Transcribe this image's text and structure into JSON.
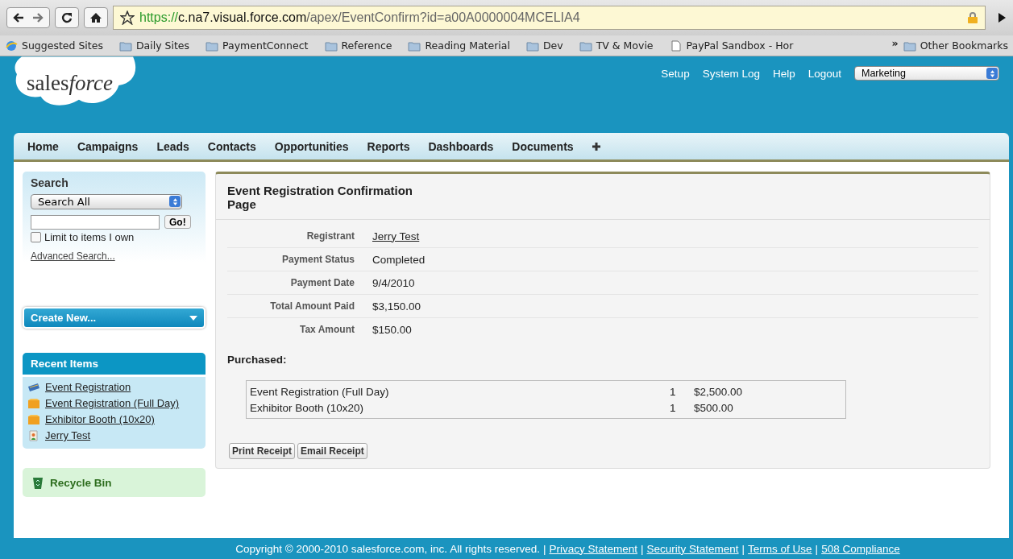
{
  "browser": {
    "url": [
      {
        "kind": "scheme",
        "text": "https://"
      },
      {
        "kind": "host",
        "text": "c.na7.visual.force.com"
      },
      {
        "kind": "path",
        "text": "/apex/EventConfirm?id=a00A0000004MCELIA4"
      }
    ],
    "bookmarks": [
      {
        "kind": "site",
        "label": "Suggested Sites"
      },
      {
        "kind": "folder",
        "label": "Daily Sites"
      },
      {
        "kind": "folder",
        "label": "PaymentConnect"
      },
      {
        "kind": "folder",
        "label": "Reference"
      },
      {
        "kind": "folder",
        "label": "Reading Material"
      },
      {
        "kind": "folder",
        "label": "Dev"
      },
      {
        "kind": "folder",
        "label": "TV & Movie"
      },
      {
        "kind": "page",
        "label": "PayPal Sandbox - Hor"
      }
    ],
    "overflow": "»",
    "other_bookmarks": "Other Bookmarks"
  },
  "header": {
    "logo": [
      {
        "kind": "plain",
        "text": "sales"
      },
      {
        "kind": "italic",
        "text": "force"
      }
    ],
    "links": [
      "Setup",
      "System Log",
      "Help",
      "Logout"
    ],
    "app": "Marketing"
  },
  "tabs": [
    {
      "label": "Home",
      "selected": false
    },
    {
      "label": "Campaigns",
      "selected": false
    },
    {
      "label": "Leads",
      "selected": false
    },
    {
      "label": "Contacts",
      "selected": false
    },
    {
      "label": "Opportunities",
      "selected": false
    },
    {
      "label": "Reports",
      "selected": false
    },
    {
      "label": "Dashboards",
      "selected": false
    },
    {
      "label": "Documents",
      "selected": false
    }
  ],
  "sidebar": {
    "search": {
      "title": "Search",
      "scope": "Search All",
      "go": "Go!",
      "limit_label": "Limit to items I own",
      "limit_checked": false,
      "advanced": "Advanced Search..."
    },
    "create_new": "Create New...",
    "recent": {
      "title": "Recent Items",
      "items": [
        {
          "kind": "event",
          "label": "Event Registration"
        },
        {
          "kind": "product",
          "label": "Event Registration (Full Day)"
        },
        {
          "kind": "product",
          "label": "Exhibitor Booth (10x20)"
        },
        {
          "kind": "contact",
          "label": "Jerry Test"
        }
      ]
    },
    "recycle_bin": "Recycle Bin"
  },
  "main": {
    "title": "Event Registration Confirmation Page",
    "fields": [
      {
        "label": "Registrant",
        "value": "Jerry Test",
        "link": true
      },
      {
        "label": "Payment Status",
        "value": "Completed",
        "link": false
      },
      {
        "label": "Payment Date",
        "value": "9/4/2010",
        "link": false
      },
      {
        "label": "Total Amount Paid",
        "value": "$3,150.00",
        "link": false
      },
      {
        "label": "Tax Amount",
        "value": "$150.00",
        "link": false
      }
    ],
    "purchased_title": "Purchased:",
    "purchased": [
      {
        "item": "Event Registration (Full Day)",
        "qty": "1",
        "price": "$2,500.00"
      },
      {
        "item": "Exhibitor Booth (10x20)",
        "qty": "1",
        "price": "$500.00"
      }
    ],
    "buttons": [
      "Print Receipt",
      "Email Receipt"
    ]
  },
  "footer": {
    "copyright": "Copyright © 2000-2010 salesforce.com, inc. All rights reserved.",
    "separator": "|",
    "links": [
      "Privacy Statement",
      "Security Statement",
      "Terms of Use",
      "508 Compliance"
    ]
  }
}
